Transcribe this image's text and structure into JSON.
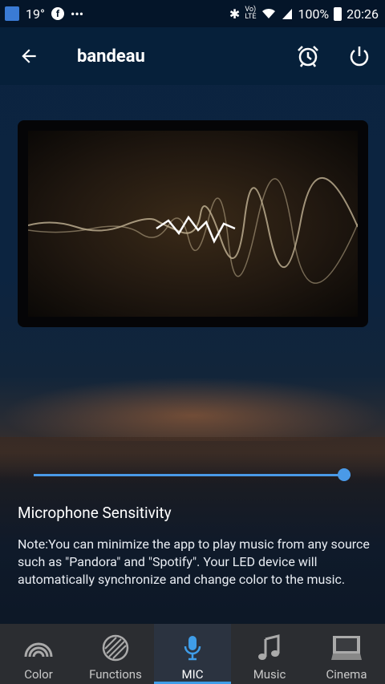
{
  "status": {
    "temp": "19°",
    "dots": "•••",
    "battery_pct": "100%",
    "time": "20:26"
  },
  "appbar": {
    "title": "bandeau"
  },
  "slider": {
    "value_fraction": 0.98
  },
  "sensitivity": {
    "label": "Microphone Sensitivity"
  },
  "note": "Note:You can minimize the app to play music from any source such as \"Pandora\" and \"Spotify\". Your LED device will automatically synchronize and change color to the music.",
  "tabs": [
    {
      "label": "Color",
      "icon": "rainbow-icon",
      "active": false
    },
    {
      "label": "Functions",
      "icon": "functions-icon",
      "active": false
    },
    {
      "label": "MIC",
      "icon": "microphone-icon",
      "active": true
    },
    {
      "label": "Music",
      "icon": "music-note-icon",
      "active": false
    },
    {
      "label": "Cinema",
      "icon": "cinema-icon",
      "active": false
    }
  ],
  "colors": {
    "accent": "#3f9de8",
    "appbar": "#06203a",
    "tabbar": "#2b2d31"
  }
}
